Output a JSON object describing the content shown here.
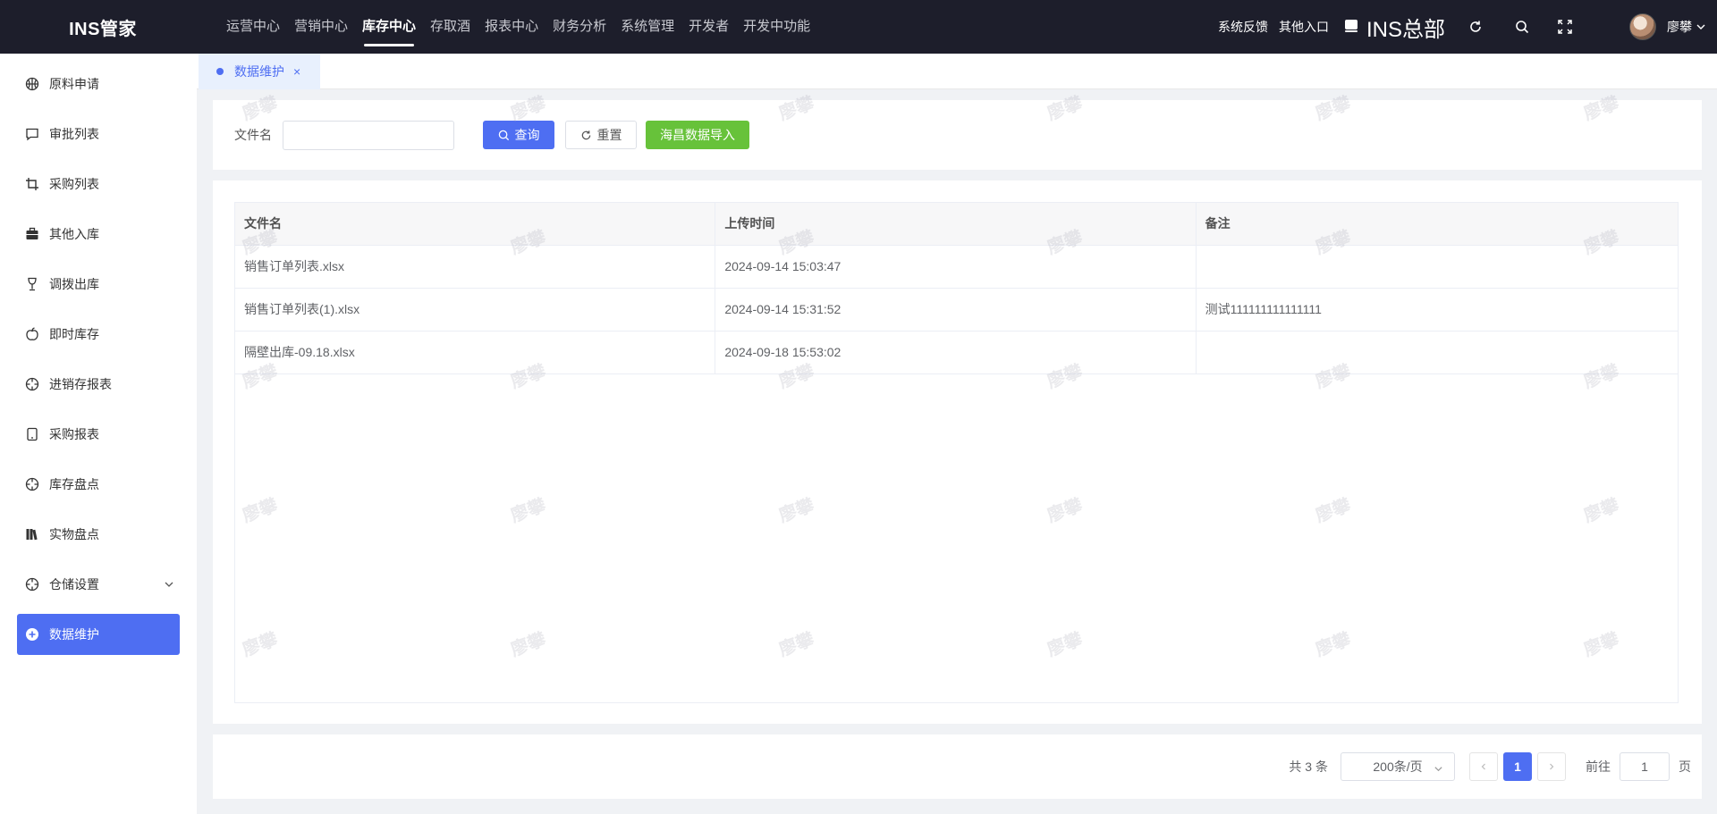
{
  "app": {
    "logo": "INS管家"
  },
  "topnav": {
    "items": [
      {
        "label": "运营中心",
        "active": false
      },
      {
        "label": "营销中心",
        "active": false
      },
      {
        "label": "库存中心",
        "active": true
      },
      {
        "label": "存取酒",
        "active": false
      },
      {
        "label": "报表中心",
        "active": false
      },
      {
        "label": "财务分析",
        "active": false
      },
      {
        "label": "系统管理",
        "active": false
      },
      {
        "label": "开发者",
        "active": false
      },
      {
        "label": "开发中功能",
        "active": false
      }
    ]
  },
  "header_right": {
    "feedback": "系统反馈",
    "other_entry": "其他入口",
    "store_name": "INS总部",
    "username": "廖攀"
  },
  "sidebar": {
    "items": [
      {
        "label": "原料申请",
        "icon": "basketball-icon"
      },
      {
        "label": "审批列表",
        "icon": "chat-icon"
      },
      {
        "label": "采购列表",
        "icon": "crop-icon"
      },
      {
        "label": "其他入库",
        "icon": "briefcase-icon"
      },
      {
        "label": "调拨出库",
        "icon": "goblet-icon"
      },
      {
        "label": "即时库存",
        "icon": "apple-icon"
      },
      {
        "label": "进销存报表",
        "icon": "aim-icon"
      },
      {
        "label": "采购报表",
        "icon": "tablet-icon"
      },
      {
        "label": "库存盘点",
        "icon": "aim-icon"
      },
      {
        "label": "实物盘点",
        "icon": "books-icon"
      },
      {
        "label": "仓储设置",
        "icon": "aim-icon"
      },
      {
        "label": "数据维护",
        "icon": "plus-circle-icon"
      }
    ]
  },
  "tabs": [
    {
      "label": "数据维护",
      "close": "×"
    }
  ],
  "search": {
    "label": "文件名",
    "value": "",
    "placeholder": "",
    "query_label": "查询",
    "reset_label": "重置",
    "import_label": "海昌数据导入"
  },
  "table": {
    "headers": [
      "文件名",
      "上传时间",
      "备注"
    ],
    "rows": [
      [
        "销售订单列表.xlsx",
        "2024-09-14 15:03:47",
        ""
      ],
      [
        "销售订单列表(1).xlsx",
        "2024-09-14 15:31:52",
        "测试111111111111111"
      ],
      [
        "隔壁出库-09.18.xlsx",
        "2024-09-18 15:53:02",
        ""
      ]
    ]
  },
  "pagination": {
    "total": "共 3 条",
    "page_size": "200条/页",
    "current_page": "1",
    "goto_label": "前往",
    "goto_value": "1",
    "page_suffix": "页"
  },
  "watermark": "廖攀",
  "colors": {
    "primary": "#4e6ef2",
    "success": "#67c23a",
    "header_bg": "#1d1e2b"
  }
}
